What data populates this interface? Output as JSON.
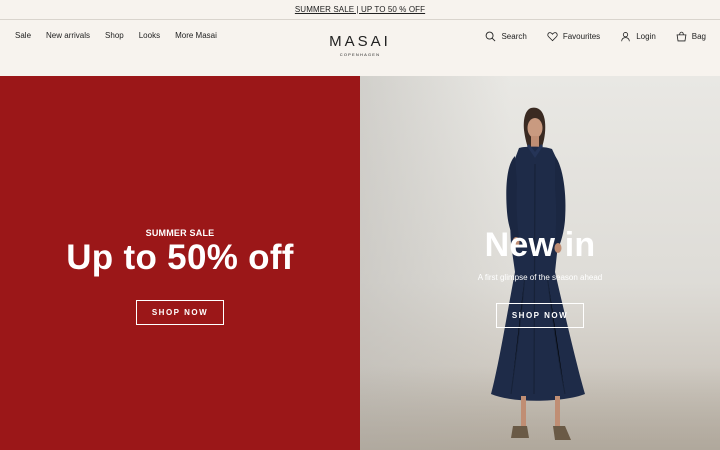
{
  "announcement": {
    "text": "SUMMER SALE | UP TO 50 % OFF"
  },
  "nav": {
    "left": [
      "Sale",
      "New arrivals",
      "Shop",
      "Looks",
      "More Masai"
    ],
    "right": [
      {
        "label": "Search",
        "icon": "search-icon"
      },
      {
        "label": "Favourites",
        "icon": "heart-icon"
      },
      {
        "label": "Login",
        "icon": "user-icon"
      },
      {
        "label": "Bag",
        "icon": "bag-icon"
      }
    ]
  },
  "logo": {
    "brand": "MASAI",
    "sub": "COPENHAGEN"
  },
  "hero_left": {
    "eyebrow": "SUMMER SALE",
    "headline": "Up to 50% off",
    "cta": "SHOP NOW",
    "background": "#9b1718"
  },
  "hero_right": {
    "headline": "New in",
    "subtitle": "A first glimpse of the season ahead",
    "cta": "SHOP NOW"
  }
}
